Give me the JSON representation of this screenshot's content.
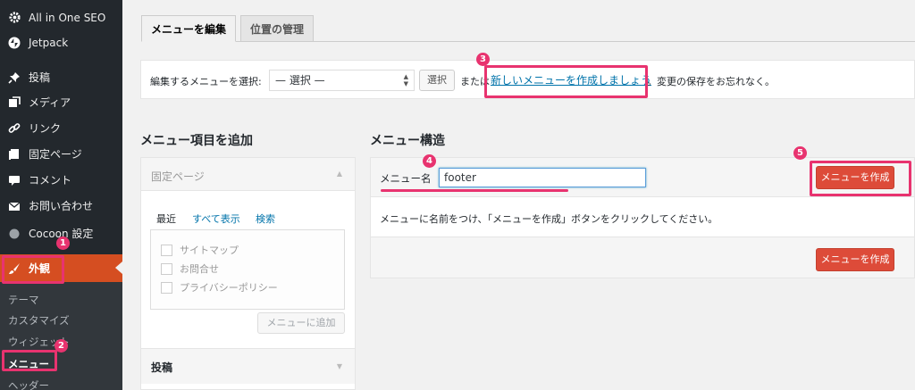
{
  "sidebar": {
    "items": [
      {
        "label": "All in One SEO",
        "icon": "gear-icon"
      },
      {
        "label": "Jetpack",
        "icon": "jetpack-icon"
      },
      {
        "label": "投稿",
        "icon": "pin-icon"
      },
      {
        "label": "メディア",
        "icon": "media-icon"
      },
      {
        "label": "リンク",
        "icon": "link-icon"
      },
      {
        "label": "固定ページ",
        "icon": "page-icon"
      },
      {
        "label": "コメント",
        "icon": "comment-icon"
      },
      {
        "label": "お問い合わせ",
        "icon": "mail-icon"
      },
      {
        "label": "Cocoon 設定",
        "icon": "circle-icon"
      },
      {
        "label": "外観",
        "icon": "brush-icon"
      }
    ],
    "submenu": [
      "テーマ",
      "カスタマイズ",
      "ウィジェット",
      "メニュー",
      "ヘッダー"
    ],
    "active_color": "#d54e21"
  },
  "tabs": {
    "edit": "メニューを編集",
    "locations": "位置の管理"
  },
  "select_bar": {
    "label": "編集するメニューを選択:",
    "selected": "— 選択 —",
    "select_button": "選択",
    "or_text": "または",
    "create_link": "新しいメニューを作成しましょう",
    "save_note": "。変更の保存をお忘れなく。"
  },
  "add_items": {
    "heading": "メニュー項目を追加",
    "pages_title": "固定ページ",
    "pages_tabs": [
      "最近",
      "すべて表示",
      "検索"
    ],
    "pages": [
      "サイトマップ",
      "お問合せ",
      "プライバシーポリシー"
    ],
    "add_button": "メニューに追加",
    "posts_title": "投稿"
  },
  "menu_structure": {
    "heading": "メニュー構造",
    "name_label": "メニュー名",
    "name_value": "footer",
    "create_button": "メニューを作成",
    "instruction": "メニューに名前をつけ、「メニューを作成」ボタンをクリックしてください。"
  },
  "annotations": {
    "color": "#e8336f",
    "badges": [
      "1",
      "2",
      "3",
      "4",
      "5"
    ]
  }
}
